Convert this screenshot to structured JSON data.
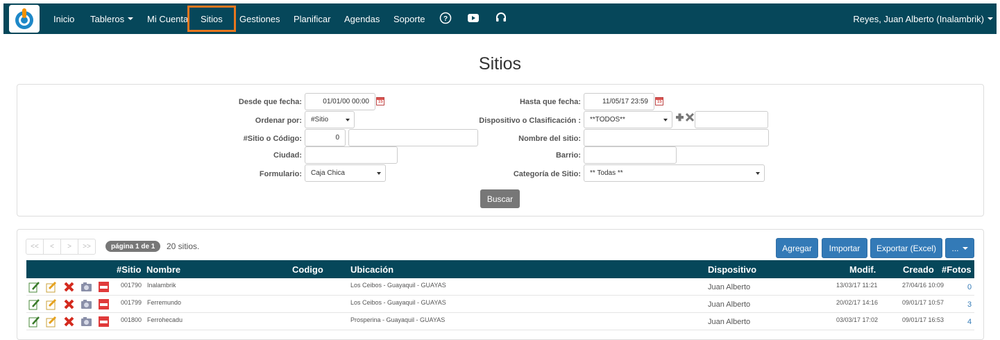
{
  "nav": {
    "items": [
      {
        "label": "Inicio"
      },
      {
        "label": "Tableros"
      },
      {
        "label": "Mi Cuenta"
      },
      {
        "label": "Sitios"
      },
      {
        "label": "Gestiones"
      },
      {
        "label": "Planificar"
      },
      {
        "label": "Agendas"
      },
      {
        "label": "Soporte"
      }
    ],
    "icons": [
      "help-icon",
      "youtube-icon",
      "headset-icon"
    ],
    "user": "Reyes, Juan Alberto (Inalambrik)"
  },
  "page_title": "Sitios",
  "filters": {
    "desde_label": "Desde que fecha:",
    "desde_value": "01/01/00 00:00",
    "hasta_label": "Hasta que fecha:",
    "hasta_value": "11/05/17 23:59",
    "ordenar_label": "Ordenar por:",
    "ordenar_value": "#Sitio",
    "dispositivo_label": "Dispositivo o Clasificación :",
    "dispositivo_value": "**TODOS**",
    "sitio_label": "#Sitio o Código:",
    "sitio_value": "0",
    "nombre_label": "Nombre del sitio:",
    "ciudad_label": "Ciudad:",
    "barrio_label": "Barrio:",
    "formulario_label": "Formulario:",
    "formulario_value": "Caja Chica",
    "categoria_label": "Categoría de Sitio:",
    "categoria_value": "** Todas **",
    "buscar": "Buscar"
  },
  "results": {
    "pager": [
      "<<",
      "<",
      ">",
      ">>"
    ],
    "page_label": "página 1 de 1",
    "count": "20 sitios.",
    "buttons": {
      "agregar": "Agregar",
      "importar": "Importar",
      "exportar": "Exportar (Excel)",
      "more": "..."
    },
    "columns": {
      "sitio": "#Sitio",
      "nombre": "Nombre",
      "codigo": "Codigo",
      "ubicacion": "Ubicación",
      "dispositivo": "Dispositivo",
      "modif": "Modif.",
      "creado": "Creado",
      "fotos": "#Fotos"
    },
    "rows": [
      {
        "sitio": "001790",
        "nombre": "Inalambrik",
        "ubicacion": "Los Ceibos - Guayaquil - GUAYAS",
        "dispositivo": "Juan Alberto",
        "modif": "13/03/17 11:21",
        "creado": "27/04/16 10:09",
        "fotos": "0"
      },
      {
        "sitio": "001799",
        "nombre": "Ferremundo",
        "ubicacion": "Los Ceibos - Guayaquil - GUAYAS",
        "dispositivo": "Juan Alberto",
        "modif": "20/02/17 14:16",
        "creado": "09/01/17 10:57",
        "fotos": "3"
      },
      {
        "sitio": "001800",
        "nombre": "Ferrohecadu",
        "ubicacion": "Prosperina - Guayaquil - GUAYAS",
        "dispositivo": "Juan Alberto",
        "modif": "03/03/17 17:02",
        "creado": "09/01/17 16:53",
        "fotos": "4"
      }
    ]
  },
  "colors": {
    "nav_bg": "#06475a",
    "active_border": "#e8771e",
    "button_blue": "#337ab7",
    "button_gray": "#777777"
  }
}
